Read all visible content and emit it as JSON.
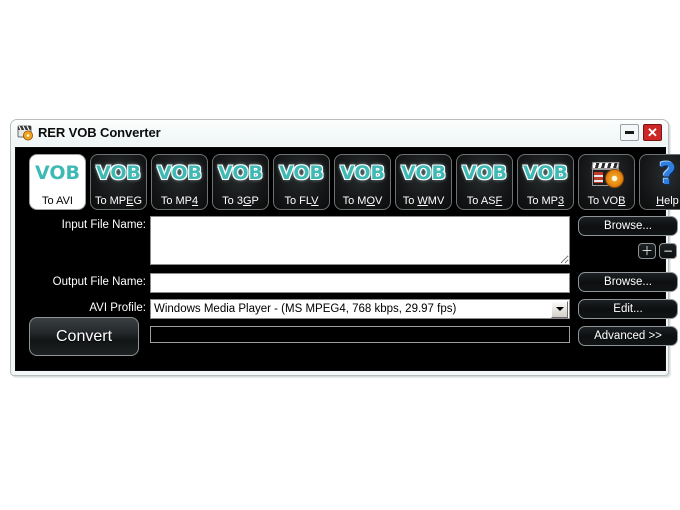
{
  "window": {
    "title": "RER VOB Converter",
    "icon": "app-disc-icon",
    "minimize_label": "",
    "close_label": "✕"
  },
  "toolbar": {
    "buttons": [
      {
        "glyph": "VOB",
        "label": "To AVI",
        "accel": "",
        "selected": true,
        "icon": "vob-text-icon"
      },
      {
        "glyph": "VOB",
        "label": "To MPEG",
        "accel": "E",
        "selected": false,
        "icon": "vob-text-icon"
      },
      {
        "glyph": "VOB",
        "label": "To MP4",
        "accel": "4",
        "selected": false,
        "icon": "vob-text-icon"
      },
      {
        "glyph": "VOB",
        "label": "To 3GP",
        "accel": "G",
        "selected": false,
        "icon": "vob-text-icon"
      },
      {
        "glyph": "VOB",
        "label": "To FLV",
        "accel": "V",
        "selected": false,
        "icon": "vob-text-icon"
      },
      {
        "glyph": "VOB",
        "label": "To MOV",
        "accel": "O",
        "selected": false,
        "icon": "vob-text-icon"
      },
      {
        "glyph": "VOB",
        "label": "To WMV",
        "accel": "W",
        "selected": false,
        "icon": "vob-text-icon"
      },
      {
        "glyph": "VOB",
        "label": "To ASF",
        "accel": "F",
        "selected": false,
        "icon": "vob-text-icon"
      },
      {
        "glyph": "VOB",
        "label": "To MP3",
        "accel": "3",
        "selected": false,
        "icon": "vob-text-icon"
      },
      {
        "glyph": "",
        "label": "To VOB",
        "accel": "B",
        "selected": false,
        "icon": "clapperboard-disc-icon"
      },
      {
        "glyph": "?",
        "label": "Help",
        "accel": "H",
        "selected": false,
        "icon": "question-mark-icon"
      }
    ]
  },
  "form": {
    "input_file_label": "Input File Name:",
    "input_file_value": "",
    "input_file_placeholder": "",
    "output_file_label": "Output File Name:",
    "output_file_value": "",
    "output_file_placeholder": "",
    "profile_label": "AVI Profile:",
    "profile_selected": "Windows Media Player - (MS MPEG4, 768 kbps, 29.97 fps)",
    "progress_percent": 0
  },
  "buttons": {
    "browse_input": "Browse...",
    "browse_output": "Browse...",
    "edit": "Edit...",
    "advanced": "Advanced >>",
    "convert": "Convert",
    "add_file": "＋",
    "remove_file": "−"
  },
  "colors": {
    "accent_teal": "#3fb9b4",
    "close_red": "#cc2727",
    "body_black": "#000000",
    "titlebar": "#f2f7f7",
    "disc_orange": "#e07b10",
    "help_blue": "#2f7fe0"
  }
}
